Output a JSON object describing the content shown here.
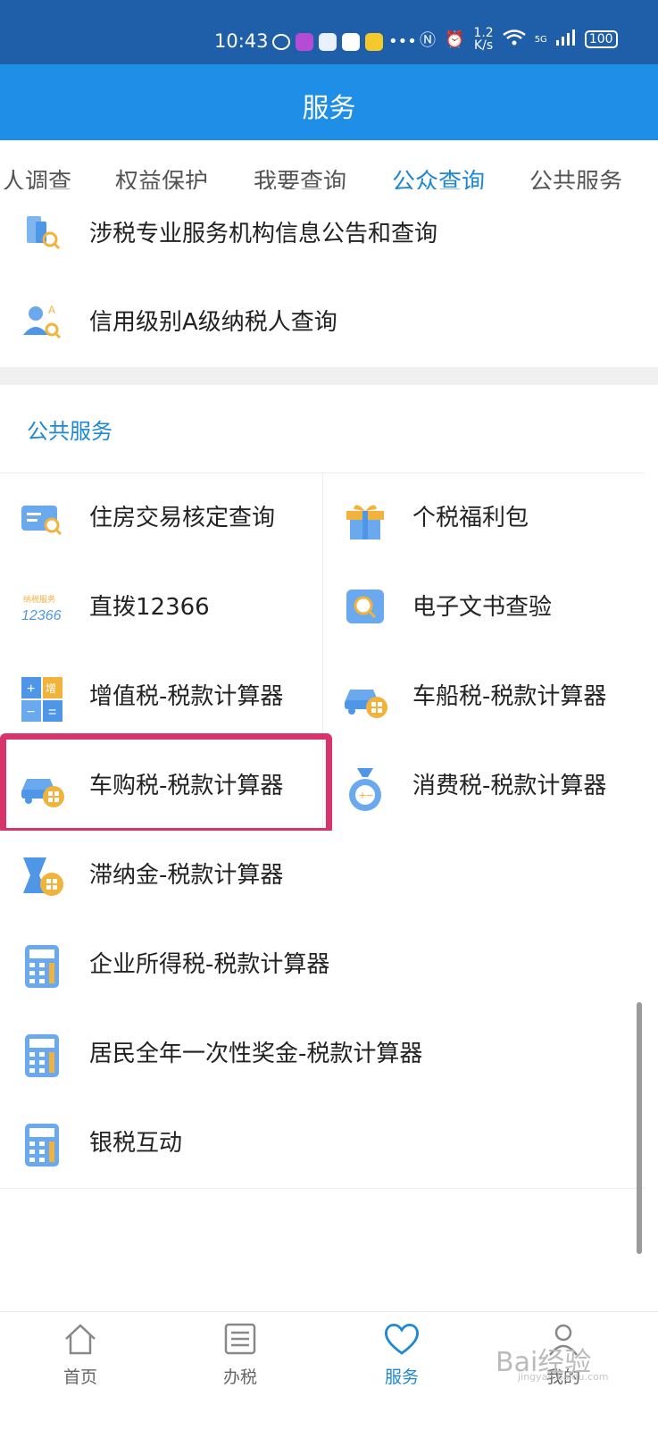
{
  "status": {
    "time": "10:43",
    "net_rate_top": "1.2",
    "net_rate_bottom": "K/s",
    "signal": "5G",
    "battery": "100"
  },
  "app": {
    "title": "服务"
  },
  "tabs": [
    {
      "label": "人调查"
    },
    {
      "label": "权益保护"
    },
    {
      "label": "我要查询"
    },
    {
      "label": "公众查询",
      "active": true
    },
    {
      "label": "公共服务"
    }
  ],
  "query_items": [
    {
      "label": "涉税专业服务机构信息公告和查询",
      "icon": "building-search-icon"
    },
    {
      "label": "信用级别A级纳税人查询",
      "icon": "user-grade-search-icon"
    }
  ],
  "section_title": "公共服务",
  "grid": [
    {
      "label": "住房交易核定查询",
      "icon": "house-search-icon"
    },
    {
      "label": "个税福利包",
      "icon": "gift-icon"
    },
    {
      "label": "直拨12366",
      "icon": "hotline-12366-icon"
    },
    {
      "label": "电子文书查验",
      "icon": "document-verify-icon"
    },
    {
      "label": "增值税-税款计算器",
      "icon": "vat-calculator-icon"
    },
    {
      "label": "车船税-税款计算器",
      "icon": "car-calculator-icon"
    },
    {
      "label": "车购税-税款计算器",
      "icon": "car-purchase-calculator-icon"
    },
    {
      "label": "消费税-税款计算器",
      "icon": "money-bag-icon"
    }
  ],
  "list": [
    {
      "label": "滞纳金-税款计算器",
      "icon": "late-fee-calculator-icon"
    },
    {
      "label": "企业所得税-税款计算器",
      "icon": "calculator-icon"
    },
    {
      "label": "居民全年一次性奖金-税款计算器",
      "icon": "calculator-icon"
    },
    {
      "label": "银税互动",
      "icon": "calculator-icon"
    }
  ],
  "bottom_nav": [
    {
      "label": "首页",
      "icon": "home-icon"
    },
    {
      "label": "办税",
      "icon": "list-icon"
    },
    {
      "label": "服务",
      "icon": "heart-icon",
      "active": true
    },
    {
      "label": "我的",
      "icon": "user-icon"
    }
  ],
  "colors": {
    "statusbar": "#1f5ea8",
    "appbar": "#1e8ee6",
    "accent": "#1e88d4",
    "highlight": "#d8336b"
  },
  "watermark": {
    "brand": "Bai经验",
    "url": "jingyan.baidu.com"
  }
}
